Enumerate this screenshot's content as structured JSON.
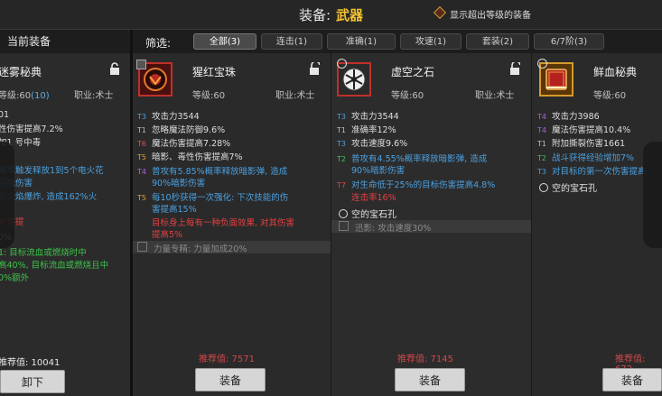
{
  "header": {
    "label": "装备:",
    "value": "武器",
    "toggle_label": "显示超出等级的装备"
  },
  "left_panel": {
    "title": "当前装备",
    "item_name": "迷雾秘典",
    "level_label": "等级:60",
    "level_bonus": "(10)",
    "job": "职业:术士",
    "lines": [
      {
        "text": "01",
        "cls": "white"
      },
      {
        "text": "性伤害提高7.2%",
        "cls": "white"
      },
      {
        "text": "加1 号中毒",
        "cls": "white"
      },
      {
        "text": "概率触发释放1到5个电火花",
        "cls": "blue"
      },
      {
        "text": "闪电伤害",
        "cls": "blue"
      },
      {
        "text": "炽火焰爆炸, 造成162%火",
        "cls": "blue"
      },
      {
        "text": "",
        "cls": "blue"
      },
      {
        "text": "对害提",
        "cls": "red"
      },
      {
        "text": "0%",
        "cls": "white"
      },
      {
        "text": "1: 目标流血或燃烧时中",
        "cls": "green"
      },
      {
        "text": "高40%, 目标流血或燃烧且中",
        "cls": "green"
      },
      {
        "text": "0%额外",
        "cls": "green"
      }
    ],
    "score_label": "推荐值: 10041",
    "button": "卸下"
  },
  "filters": {
    "label": "筛选:",
    "chips": [
      "全部(3)",
      "连击(1)",
      "准确(1)",
      "攻速(1)",
      "套装(2)",
      "6/7阶(3)"
    ]
  },
  "items": [
    {
      "name": "猩红宝珠",
      "level": "等级:60",
      "job": "职业:术士",
      "lines": [
        {
          "tag": "T3",
          "tc": "t3",
          "text": "攻击力3544",
          "cls": "white"
        },
        {
          "tag": "T1",
          "tc": "t1",
          "text": "忽略魔法防御9.6%",
          "cls": "white"
        },
        {
          "tag": "T6",
          "tc": "t6",
          "text": "魔法伤害提高7.28%",
          "cls": "white"
        },
        {
          "tag": "T5",
          "tc": "t5",
          "text": "暗影、毒性伤害提高7%",
          "cls": "white"
        },
        {
          "tag": "T4",
          "tc": "t4",
          "text": "普攻有5.85%概率释放暗影弹, 造成",
          "cls": "blue"
        },
        {
          "tag": "",
          "tc": "t4",
          "text": "90%暗影伤害",
          "cls": "blue"
        },
        {
          "tag": "T5",
          "tc": "t5",
          "text": "每10秒获得一次强化: 下次技能的伤",
          "cls": "blue"
        },
        {
          "tag": "",
          "tc": "t5",
          "text": "害提高15%",
          "cls": "blue"
        },
        {
          "tag": "",
          "tc": "t6",
          "text": "目标身上每有一种负面效果, 对其伤害",
          "cls": "red"
        },
        {
          "tag": "",
          "tc": "t6",
          "text": "提高5%",
          "cls": "red"
        }
      ],
      "socket": "",
      "gray_line": "力量专精: 力量加成20%",
      "score": "推荐值: 7571",
      "button": "装备"
    },
    {
      "name": "虚空之石",
      "level": "等级:60",
      "job": "职业:术士",
      "lines": [
        {
          "tag": "T3",
          "tc": "t3",
          "text": "攻击力3544",
          "cls": "white"
        },
        {
          "tag": "T1",
          "tc": "t1",
          "text": "准确率12%",
          "cls": "white"
        },
        {
          "tag": "T3",
          "tc": "t3",
          "text": "攻击速度9.6%",
          "cls": "white"
        },
        {
          "tag": "T2",
          "tc": "t2",
          "text": "普攻有4.55%概率释放暗影弹, 造成",
          "cls": "blue"
        },
        {
          "tag": "",
          "tc": "t2",
          "text": "90%暗影伤害",
          "cls": "blue"
        },
        {
          "tag": "T7",
          "tc": "t7",
          "text": "对生命低于25%的目标伤害提高4.8%",
          "cls": "blue"
        },
        {
          "tag": "",
          "tc": "t7",
          "text": "连击率16%",
          "cls": "red"
        }
      ],
      "socket": "空的宝石孔",
      "gray_line": "迅影: 攻击速度30%",
      "score": "推荐值: 7145",
      "button": "装备"
    },
    {
      "name": "鲜血秘典",
      "level": "等级:60",
      "job": "职业:术士",
      "lines": [
        {
          "tag": "T4",
          "tc": "t4",
          "text": "攻击力3986",
          "cls": "white"
        },
        {
          "tag": "T4",
          "tc": "t4",
          "text": "魔法伤害提高10.4%",
          "cls": "white"
        },
        {
          "tag": "T1",
          "tc": "t1",
          "text": "附加撕裂伤害1661",
          "cls": "white"
        },
        {
          "tag": "T2",
          "tc": "t2",
          "text": "战斗获得经验增加7%",
          "cls": "blue"
        },
        {
          "tag": "T3",
          "tc": "t3",
          "text": "对目标的第一次伤害提高",
          "cls": "blue"
        }
      ],
      "socket": "空的宝石孔",
      "gray_line": "",
      "score": "推荐值: 672",
      "button": "装备"
    }
  ],
  "colors": {
    "accent_gold": "#f2c230",
    "rare_red": "#c0302a",
    "legend_gold": "#d79a2a"
  }
}
